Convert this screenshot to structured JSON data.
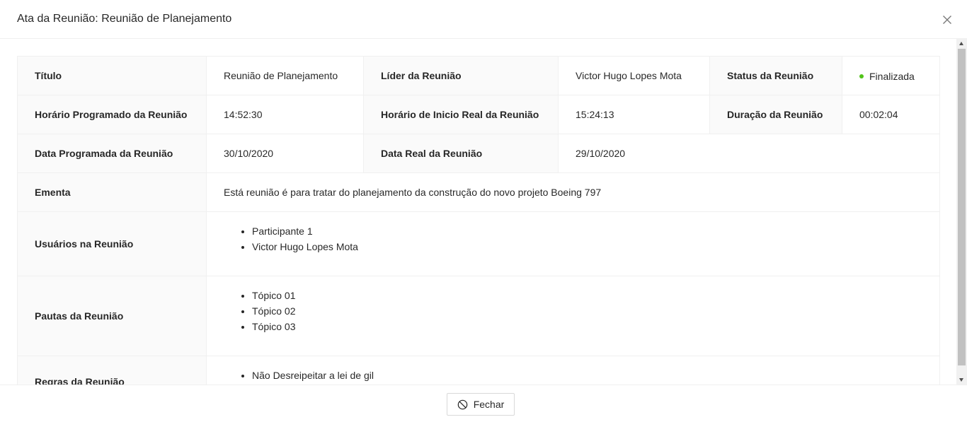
{
  "modal": {
    "title": "Ata da Reunião: Reunião de Planejamento"
  },
  "fields": {
    "titulo_label": "Título",
    "titulo_value": "Reunião de Planejamento",
    "lider_label": "Líder da Reunião",
    "lider_value": "Victor Hugo Lopes Mota",
    "status_label": "Status da Reunião",
    "status_value": "Finalizada",
    "status_color": "#52c41a",
    "horario_prog_label": "Horário Programado da Reunião",
    "horario_prog_value": "14:52:30",
    "horario_real_label": "Horário de Inicio Real da Reunião",
    "horario_real_value": "15:24:13",
    "duracao_label": "Duração da Reunião",
    "duracao_value": "00:02:04",
    "data_prog_label": "Data Programada da Reunião",
    "data_prog_value": "30/10/2020",
    "data_real_label": "Data Real da Reunião",
    "data_real_value": "29/10/2020",
    "ementa_label": "Ementa",
    "ementa_value": "Está reunião é para tratar do planejamento da construção do novo projeto Boeing 797",
    "usuarios_label": "Usuários na Reunião",
    "usuarios": [
      "Participante 1",
      "Victor Hugo Lopes Mota"
    ],
    "pautas_label": "Pautas da Reunião",
    "pautas": [
      "Tópico 01",
      "Tópico 02",
      "Tópico 03"
    ],
    "regras_label": "Regras da Reunião",
    "regras": [
      "Não Desreipeitar a lei de gil"
    ]
  },
  "footer": {
    "close_label": "Fechar"
  },
  "icons": {
    "close": "close-icon",
    "stop": "stop-icon"
  }
}
